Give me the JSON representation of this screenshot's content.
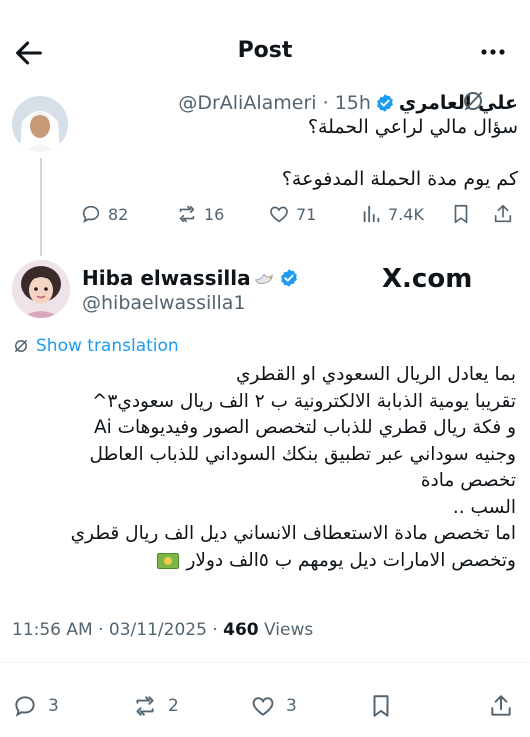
{
  "header": {
    "title": "Post"
  },
  "parent_post": {
    "author_name": "علي العامري",
    "handle": "@DrAliAlameri",
    "separator": "·",
    "time": "15h",
    "lines": [
      "سؤال مالي لراعي الحملة؟",
      "كم يوم مدة الحملة المدفوعة؟"
    ],
    "stats": {
      "replies": "82",
      "reposts": "16",
      "likes": "71",
      "views": "7.4K"
    }
  },
  "main_post": {
    "author_name": "Hiba elwassilla",
    "handle": "@hibaelwassilla1",
    "watermark": "X.com",
    "translate_label": "Show translation",
    "lines": [
      "بما يعادل الريال السعودي او القطري",
      "تقريبا يومية الذبابة الالكترونية ب ٢ الف ريال سعودي٣^",
      "و فكة ريال قطري للذباب لتخصص الصور وفيديوهات Ai",
      "وجنيه سوداني عبر تطبيق بنكك السوداني للذباب العاطل",
      "تخصص مادة",
      "السب ..",
      "اما تخصص مادة الاستعطاف الانساني ديل الف ريال قطري",
      "وتخصص الامارات ديل يومهم ب ٥الف دولار"
    ],
    "timestamp": "11:56 AM · 03/11/2025 · ",
    "views_count": "460",
    "views_label": " Views",
    "stats": {
      "replies": "3",
      "reposts": "2",
      "likes": "3"
    }
  },
  "colors": {
    "accent": "#1d9bf0",
    "secondary_text": "#536471",
    "primary_text": "#0f1419"
  },
  "icons": {
    "back": "arrow-left-icon",
    "more": "more-horizontal-icon",
    "verified": "verified-badge-icon",
    "grok": "grok-icon",
    "reply": "reply-icon",
    "repost": "repost-icon",
    "like": "heart-icon",
    "views": "views-icon",
    "bookmark": "bookmark-icon",
    "share": "share-icon",
    "dove": "dove-emoji-icon",
    "money": "money-emoji-icon"
  }
}
